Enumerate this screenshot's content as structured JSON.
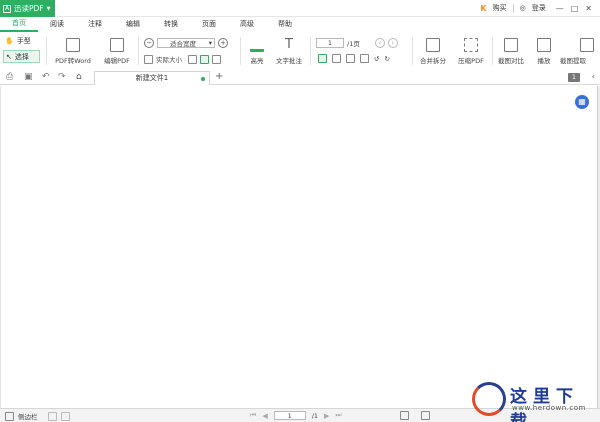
{
  "app": {
    "name": "迅读PDF"
  },
  "menu": {
    "tabs": [
      "首页",
      "阅读",
      "注释",
      "编辑",
      "转换",
      "页面",
      "高级",
      "帮助"
    ],
    "active_index": 0
  },
  "topright": {
    "buy": "购买",
    "login": "登录",
    "minimize": "—",
    "maximize": "□",
    "close": "✕"
  },
  "ribbon": {
    "hand": "手型",
    "select": "选择",
    "pdf_to_word": "PDF转Word",
    "edit_pdf": "编辑PDF",
    "zoom_select": "适合宽度",
    "actual_size": "实际大小",
    "highlight": "高亮",
    "text_note": "文字批注",
    "page_value": "1",
    "page_total": "/1页",
    "merge_split": "合并拆分",
    "compress": "压缩PDF",
    "screenshot_compare": "截图对比",
    "play": "播放",
    "screenshot_ocr": "截图提取"
  },
  "tabstrip": {
    "doc_tab": "新建文件1",
    "page_badge": "1"
  },
  "status": {
    "sidebar": "侧边栏",
    "page_value": "1",
    "page_total": "/1"
  },
  "watermark": {
    "text": "这里下载",
    "url": "www.herdown.com"
  },
  "colors": {
    "accent": "#2fae61",
    "fab": "#3a6fd8"
  }
}
